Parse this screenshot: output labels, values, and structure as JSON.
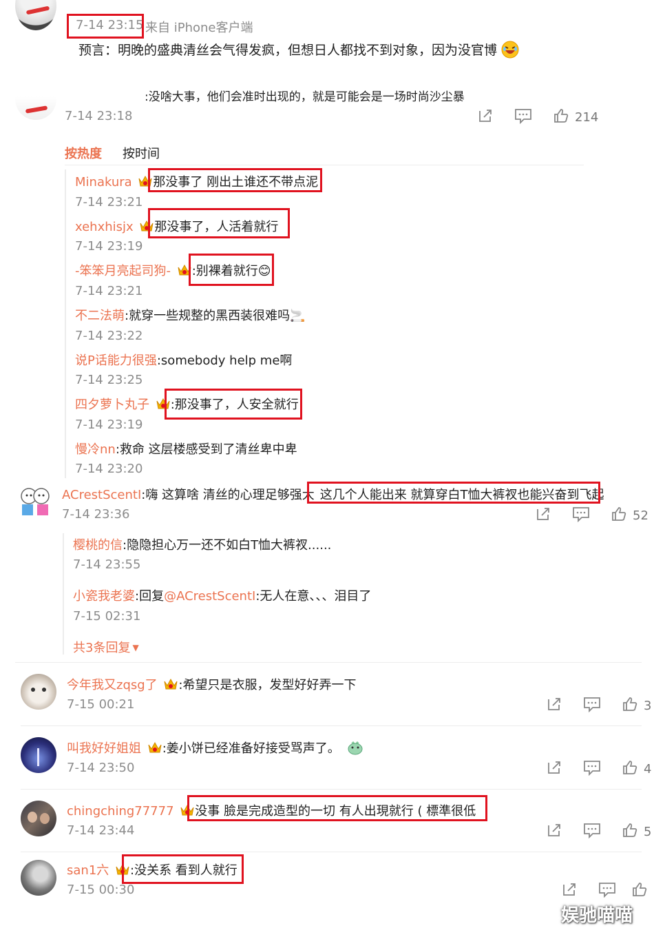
{
  "post_top": {
    "time": "7-14 23:15",
    "source": "来自 iPhone客户端",
    "text": "预言：明晚的盛典清丝会气得发疯，但想日人都找不到对象，因为没官博",
    "reply": ":没啥大事，他们会准时出现的，就是可能会是一场时尚沙尘暴",
    "reply_time": "7-14 23:18",
    "likes": "214"
  },
  "sort_tabs": {
    "hot": "按热度",
    "time": "按时间"
  },
  "sub_replies_1": [
    {
      "user": "Minakura",
      "text": "那没事了 刚出土谁还不带点泥",
      "time": "7-14 23:21"
    },
    {
      "user": "xehxhisjx",
      "text": "那没事了，人活着就行",
      "time": "7-14 23:19"
    },
    {
      "user": "-笨笨月亮起司狗-",
      "text": ":别裸着就行😊",
      "time": "7-14 23:21"
    },
    {
      "user": "不二法萌",
      "text": ":就穿一些规整的黑西装很难吗🚬",
      "time": "7-14 23:22"
    },
    {
      "user": "说P话能力很强",
      "text": ":somebody help me啊",
      "time": "7-14 23:25"
    },
    {
      "user": "四夕萝卜丸子",
      "text": ":那没事了，人安全就行",
      "time": "7-14 23:19"
    },
    {
      "user": "慢冷nn",
      "text": ":救命 这层楼感受到了清丝卑中卑",
      "time": "7-14 23:20"
    }
  ],
  "comment_acrest": {
    "user": "ACrestScentI",
    "text_a": ":嗨 这算啥 清丝的心理足够强大",
    "text_b": "这几个人能出来 就算穿白T恤大裤衩也能兴奋到飞起",
    "time": "7-14 23:36",
    "likes": "52",
    "replies": [
      {
        "user": "樱桃的信",
        "text": ":隐隐担心万一还不如白T恤大裤衩......",
        "time": "7-14 23:55"
      },
      {
        "user": "小瓷我老婆",
        "text": ":回复",
        "mention": "@ACrestScentI",
        "text2": ":无人在意、、、泪目了",
        "time": "7-15 02:31"
      }
    ],
    "more": "共3条回复"
  },
  "comments": [
    {
      "user": "今年我又zqsg了",
      "text": ":希望只是衣服，发型好好弄一下",
      "time": "7-15 00:21",
      "likes": "3"
    },
    {
      "user": "叫我好好姐姐",
      "text": ":姜小饼已经准备好接受骂声了。",
      "time": "7-14 23:50",
      "likes": "4"
    },
    {
      "user": "chingching77777",
      "text": "没事 臉是完成造型的一切 有人出現就行 ( 標準很低",
      "time": "7-14 23:44",
      "likes": "5"
    },
    {
      "user": "san1六",
      "text": ":没关系 看到人就行",
      "time": "7-15 00:30",
      "likes": ""
    }
  ],
  "watermark": "娱驰喵喵",
  "colors": {
    "accent": "#eb7350",
    "highlight": "#e0121f",
    "gray": "#8c8c8c"
  }
}
